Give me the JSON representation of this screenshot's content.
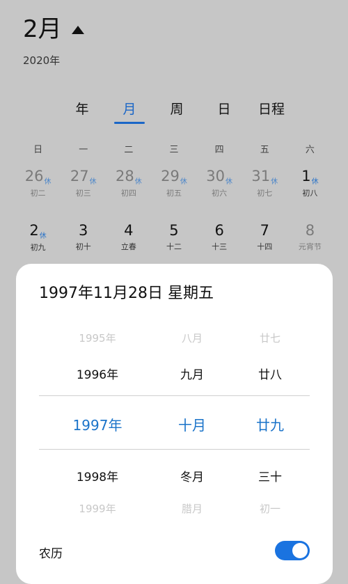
{
  "header": {
    "month_title": "2月",
    "year": "2020年"
  },
  "view_tabs": [
    "年",
    "月",
    "周",
    "日",
    "日程"
  ],
  "active_tab": "月",
  "weekdays": [
    "日",
    "一",
    "二",
    "三",
    "四",
    "五",
    "六"
  ],
  "calendar": {
    "row1": [
      {
        "num": "26",
        "badge": "休",
        "lunar": "初二",
        "faded": true
      },
      {
        "num": "27",
        "badge": "休",
        "lunar": "初三",
        "faded": true
      },
      {
        "num": "28",
        "badge": "休",
        "lunar": "初四",
        "faded": true
      },
      {
        "num": "29",
        "badge": "休",
        "lunar": "初五",
        "faded": true
      },
      {
        "num": "30",
        "badge": "休",
        "lunar": "初六",
        "faded": true
      },
      {
        "num": "31",
        "badge": "休",
        "lunar": "初七",
        "faded": true
      },
      {
        "num": "1",
        "badge": "休",
        "lunar": "初八",
        "faded": false
      }
    ],
    "row2": [
      {
        "num": "2",
        "badge": "休",
        "lunar": "初九",
        "faded": false
      },
      {
        "num": "3",
        "badge": "",
        "lunar": "初十",
        "faded": false
      },
      {
        "num": "4",
        "badge": "",
        "lunar": "立春",
        "faded": false
      },
      {
        "num": "5",
        "badge": "",
        "lunar": "十二",
        "faded": false
      },
      {
        "num": "6",
        "badge": "",
        "lunar": "十三",
        "faded": false
      },
      {
        "num": "7",
        "badge": "",
        "lunar": "十四",
        "faded": false
      },
      {
        "num": "8",
        "badge": "",
        "lunar": "元宵节",
        "faded": true
      }
    ]
  },
  "picker": {
    "title": "1997年11月28日 星期五",
    "year_options": [
      "1995年",
      "1996年",
      "1997年",
      "1998年",
      "1999年"
    ],
    "month_options": [
      "八月",
      "九月",
      "十月",
      "冬月",
      "腊月"
    ],
    "day_options": [
      "廿七",
      "廿八",
      "廿九",
      "三十",
      "初一"
    ],
    "lunar_label": "农历",
    "lunar_enabled": true
  },
  "colors": {
    "accent": "#1a73c9",
    "toggle_on": "#1a73e0",
    "background": "#c6c6c6"
  }
}
